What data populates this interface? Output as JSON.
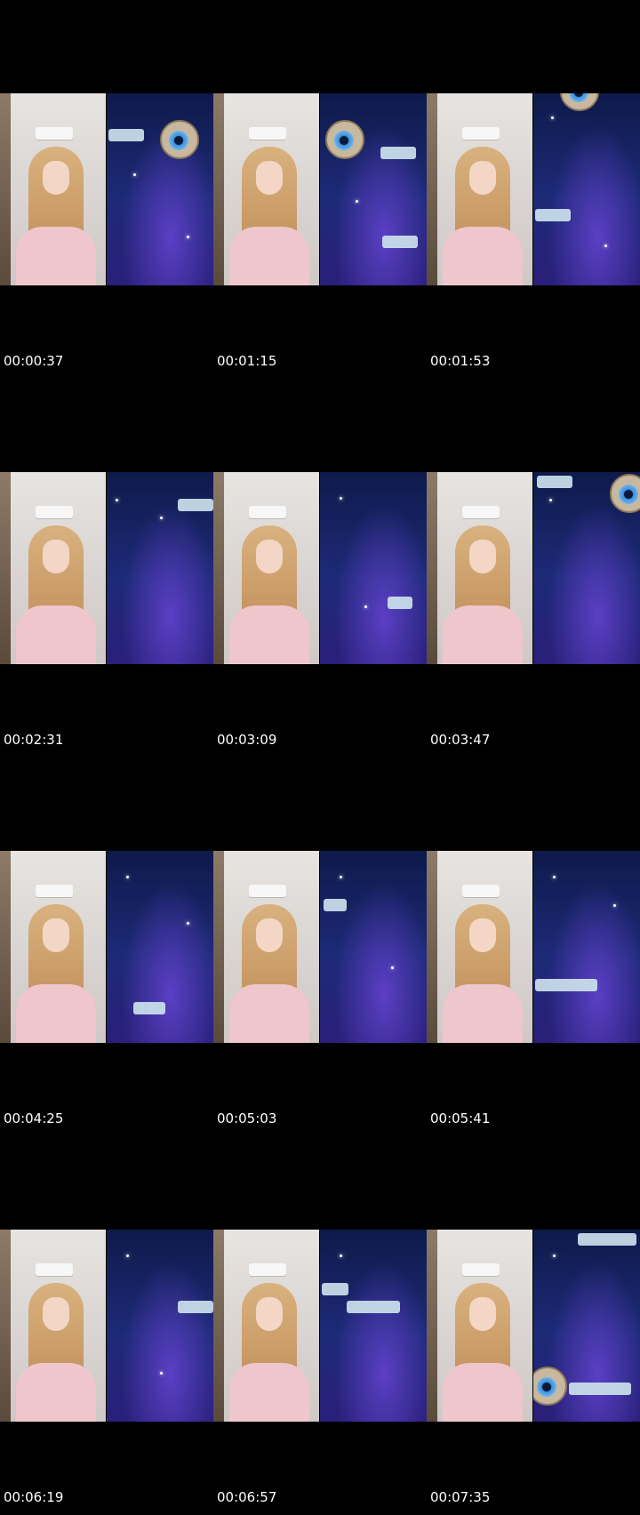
{
  "contact_sheet": {
    "thumbnails": [
      {
        "time": "00:00:37"
      },
      {
        "time": "00:01:15"
      },
      {
        "time": "00:01:53"
      },
      {
        "time": "00:02:31"
      },
      {
        "time": "00:03:09"
      },
      {
        "time": "00:03:47"
      },
      {
        "time": "00:04:25"
      },
      {
        "time": "00:05:03"
      },
      {
        "time": "00:05:41"
      },
      {
        "time": "00:06:19"
      },
      {
        "time": "00:06:57"
      },
      {
        "time": "00:07:35"
      }
    ]
  },
  "colors": {
    "background": "#000000",
    "timestamp_text": "#ffffff",
    "space_dark": "#0e1a4a",
    "space_nebula": "#5b3fc4",
    "shirt_pink": "#efc6cc",
    "hair_blonde": "#d9b27f"
  }
}
